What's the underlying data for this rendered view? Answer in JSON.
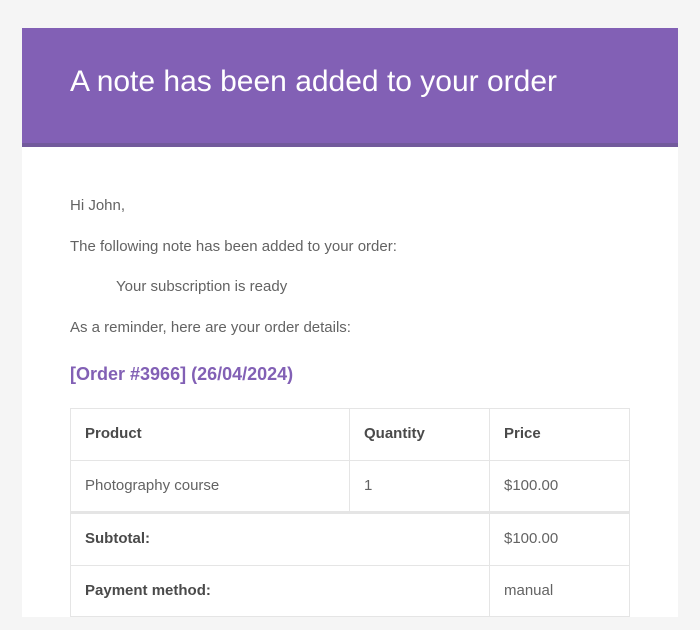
{
  "header": {
    "title": "A note has been added to your order"
  },
  "body": {
    "greeting": "Hi John,",
    "intro": "The following note has been added to your order:",
    "note": "Your subscription is ready",
    "reminder": "As a reminder, here are your order details:"
  },
  "order": {
    "heading_prefix": "[Order #",
    "number": "3966",
    "heading_suffix": "]",
    "date": "(26/04/2024)"
  },
  "table": {
    "headers": {
      "product": "Product",
      "quantity": "Quantity",
      "price": "Price"
    },
    "items": [
      {
        "product": "Photography course",
        "quantity": "1",
        "price": "$100.00"
      }
    ],
    "totals": {
      "subtotal_label": "Subtotal:",
      "subtotal_value": "$100.00",
      "payment_method_label": "Payment method:",
      "payment_method_value": "manual"
    }
  }
}
